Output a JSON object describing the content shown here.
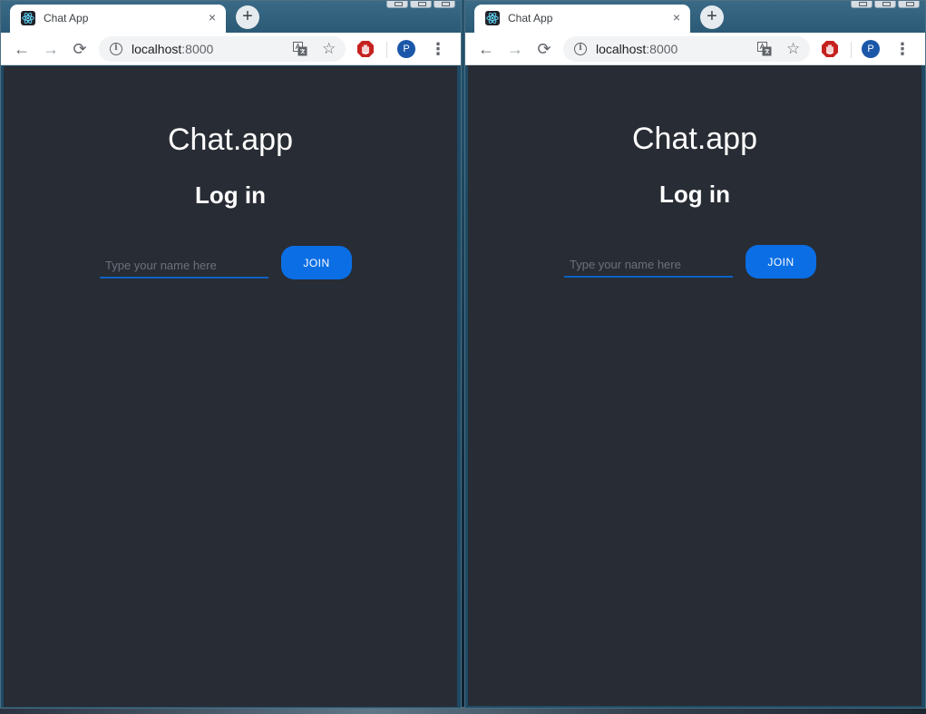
{
  "windows": [
    {
      "tab": {
        "title": "Chat App",
        "close": "×"
      },
      "newtab": "+",
      "nav": {
        "back": "←",
        "forward": "→",
        "reload": "⟳"
      },
      "address": {
        "host": "localhost",
        "port": ":8000"
      },
      "profile": {
        "initial": "P"
      },
      "menu": "⋮",
      "app": {
        "title": "Chat.app",
        "heading": "Log in",
        "name_placeholder": "Type your name here",
        "join_label": "JOIN"
      }
    },
    {
      "tab": {
        "title": "Chat App",
        "close": "×"
      },
      "newtab": "+",
      "nav": {
        "back": "←",
        "forward": "→",
        "reload": "⟳"
      },
      "address": {
        "host": "localhost",
        "port": ":8000"
      },
      "profile": {
        "initial": "P"
      },
      "menu": "⋮",
      "app": {
        "title": "Chat.app",
        "heading": "Log in",
        "name_placeholder": "Type your name here",
        "join_label": "JOIN"
      }
    }
  ],
  "colors": {
    "page_background": "#282c34",
    "accent": "#0b6ee4",
    "profile_avatar": "#1a57a8",
    "extension_icon": "#c5221f"
  },
  "icons": {
    "tab_favicon": "react-logo-icon",
    "info": "info-icon",
    "translate": "translate-icon",
    "bookmark": "star-icon",
    "extension": "adblock-hand-icon"
  }
}
